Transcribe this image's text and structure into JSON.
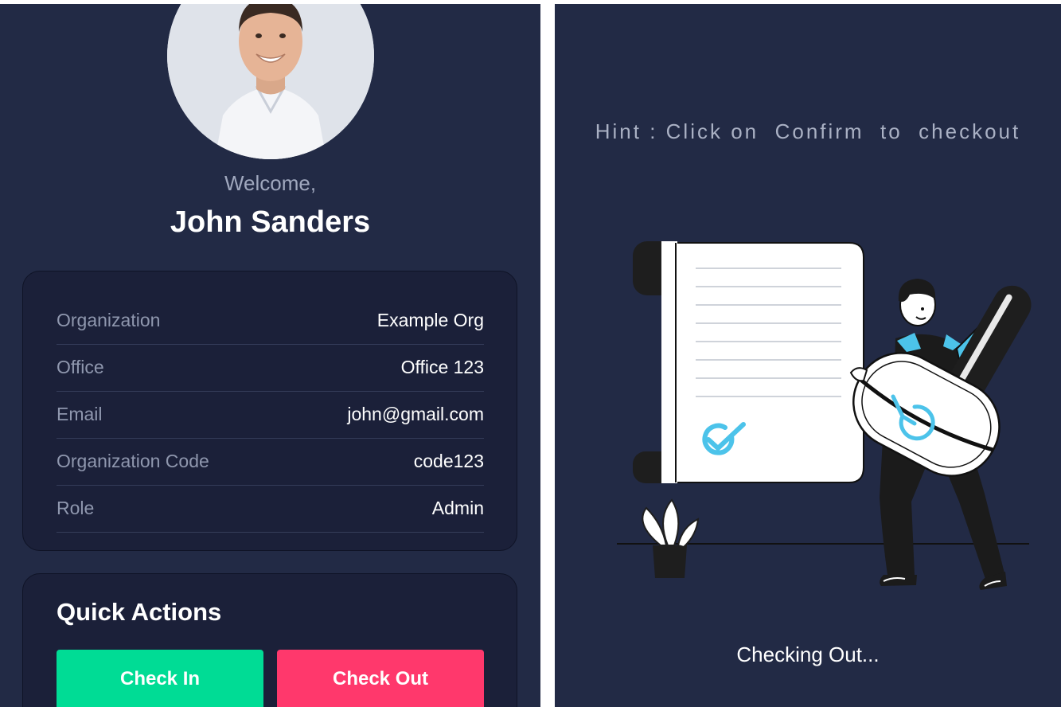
{
  "profile": {
    "welcome": "Welcome,",
    "name": "John Sanders"
  },
  "details": [
    {
      "label": "Organization",
      "value": "Example Org"
    },
    {
      "label": "Office",
      "value": "Office 123"
    },
    {
      "label": "Email",
      "value": "john@gmail.com"
    },
    {
      "label": "Organization Code",
      "value": "code123"
    },
    {
      "label": "Role",
      "value": "Admin"
    }
  ],
  "quick_actions": {
    "title": "Quick Actions",
    "check_in_label": "Check In",
    "check_out_label": "Check Out"
  },
  "checkout_screen": {
    "hint": "Hint : Click on  Confirm  to  checkout",
    "status": "Checking Out..."
  },
  "colors": {
    "background": "#222a45",
    "card": "#1b2039",
    "check_in": "#00dc95",
    "check_out": "#ff386c",
    "accent_blue": "#4cc3ea"
  },
  "icons": [
    "avatar-photo",
    "checkmark-icon",
    "clock-icon",
    "plant-icon"
  ]
}
